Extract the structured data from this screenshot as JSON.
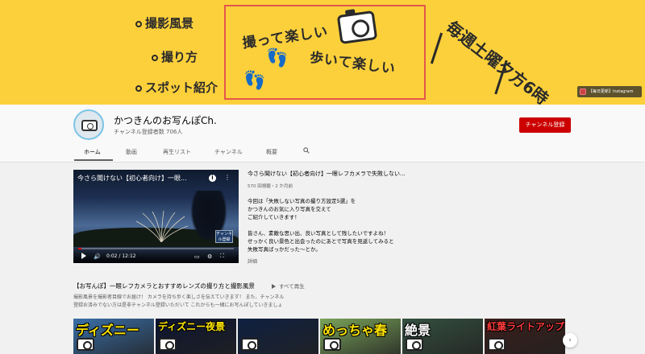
{
  "banner": {
    "bullets": [
      "撮影風景",
      "撮り方",
      "スポット紹介"
    ],
    "line1": "撮って楽しい",
    "line2": "歩いて楽しい",
    "schedule": "毎週土曜夕方6時",
    "instagram_link": "【毎日更新】Instagram",
    "icon_camera": "camera-icon",
    "icon_feet": "footprints-icon"
  },
  "channel": {
    "name": "かつきんのお写んぽCh.",
    "subscribers": "チャンネル登録者数 706人",
    "subscribe_label": "チャンネル登録",
    "accent": "#cc0000"
  },
  "tabs": [
    "ホーム",
    "動画",
    "再生リスト",
    "チャンネル",
    "概要"
  ],
  "active_tab": "ホーム",
  "featured_video": {
    "overlay_title": "今さら聞けない【初心者向け】一眼...",
    "title": "今さら聞けない【初心者向け】一眼レフカメラで失敗しない...",
    "meta": "570 回視聴・2 か月前",
    "time": "0:02 / 12:12",
    "progress": 0.02,
    "sub_badge": "チャンネル登録",
    "description": [
      "今回は「失敗しない写真の撮り方設定5選」を",
      "かつきんのお気に入り写真を交えて",
      "ご紹介していきます！",
      "",
      "皆さん、素敵な思い出、良い写真として残したいですよね！",
      "せっかく良い景色と出会ったのにあとで写真を見返してみると",
      "失敗写真ばっかだった〜とか。"
    ],
    "more_label": "詳細"
  },
  "playlist": {
    "title": "【お写んぽ】一眼レフカメラとおすすめレンズの撮り方と撮影風景",
    "play_all": "すべて再生",
    "desc": [
      "撮影風景を撮影者目線でお届け！ カメラを持ち歩く楽しさを伝えていきます！ また、チャンネル",
      "登録お済みでない方は是非チャンネル登録いただいて これからも一緒にお写んぽしていきましょ"
    ],
    "thumbs": [
      {
        "text": "ディズニー",
        "color": "#ffe600",
        "bg": "#3a6fa8"
      },
      {
        "text": "ディズニー夜景",
        "color": "#ffe600",
        "bg": "#0d1530"
      },
      {
        "text": "",
        "color": "#ffffff",
        "bg": "#0f2040"
      },
      {
        "text": "めっちゃ春",
        "color": "#ffe600",
        "bg": "#7aa35a"
      },
      {
        "text": "絶景",
        "color": "#ffffff",
        "bg": "#345040"
      },
      {
        "text": "紅葉ライトアップ",
        "color": "#ff3b3b",
        "bg": "#3a1e1a"
      }
    ]
  }
}
